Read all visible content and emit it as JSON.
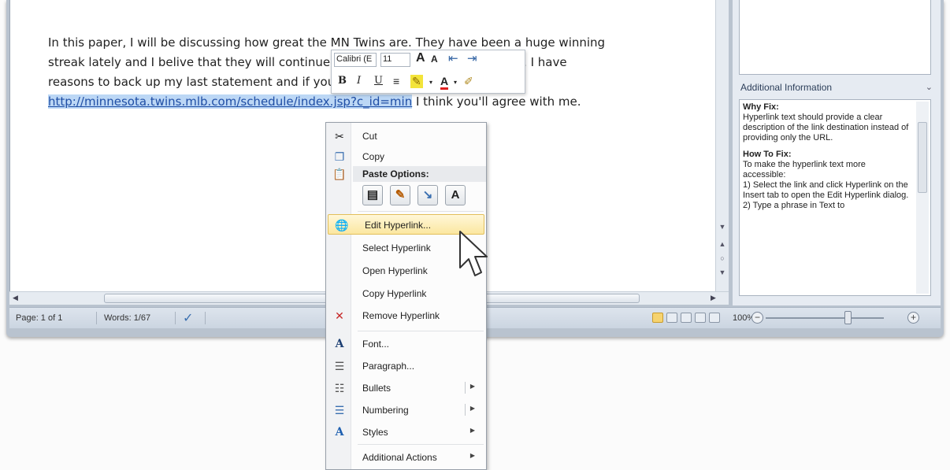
{
  "document": {
    "line1": "In this paper, I will be discussing how great the MN Twins are. They have been a huge winning",
    "line2": "streak lately and I belive that they will continue to win for the rest of the season. I have",
    "line3": "reasons to back up my last statement and if you go here:",
    "link": "http://minnesota.twins.mlb.com/schedule/index.jsp?c_id=min",
    "after_link": " I think you'll agree with me."
  },
  "statusbar": {
    "page": "Page: 1 of 1",
    "words": "Words: 1/67",
    "zoom": "100%",
    "zoom_minus": "−",
    "zoom_plus": "+"
  },
  "task_pane": {
    "header": "Additional Information",
    "why_fix_title": "Why Fix:",
    "why_fix_body": "Hyperlink text should provide a clear description of the link destination instead of providing only the URL.",
    "how_to_fix_title": "How To Fix:",
    "how_to_fix_body": "To make the hyperlink text more accessible:",
    "step1": "1) Select the link and click Hyperlink on the Insert tab to open the Edit Hyperlink dialog.",
    "step2": "2) Type a phrase in Text to"
  },
  "mini_toolbar": {
    "font": "Calibri (E",
    "size": "11",
    "bold": "B",
    "italic": "I",
    "underline": "U",
    "grow": "A",
    "shrink": "A"
  },
  "context_menu": {
    "cut": "Cut",
    "copy": "Copy",
    "paste_options": "Paste Options:",
    "paste_text": "A",
    "edit_hyperlink": "Edit Hyperlink...",
    "select_hyperlink": "Select Hyperlink",
    "open_hyperlink": "Open Hyperlink",
    "copy_hyperlink": "Copy Hyperlink",
    "remove_hyperlink": "Remove Hyperlink",
    "font": "Font...",
    "paragraph": "Paragraph...",
    "bullets": "Bullets",
    "numbering": "Numbering",
    "styles": "Styles",
    "additional_actions": "Additional Actions"
  },
  "colors": {
    "link": "#1f4ea5",
    "selection": "#bcd7f5",
    "menu_hover": "#fbe7a0"
  }
}
